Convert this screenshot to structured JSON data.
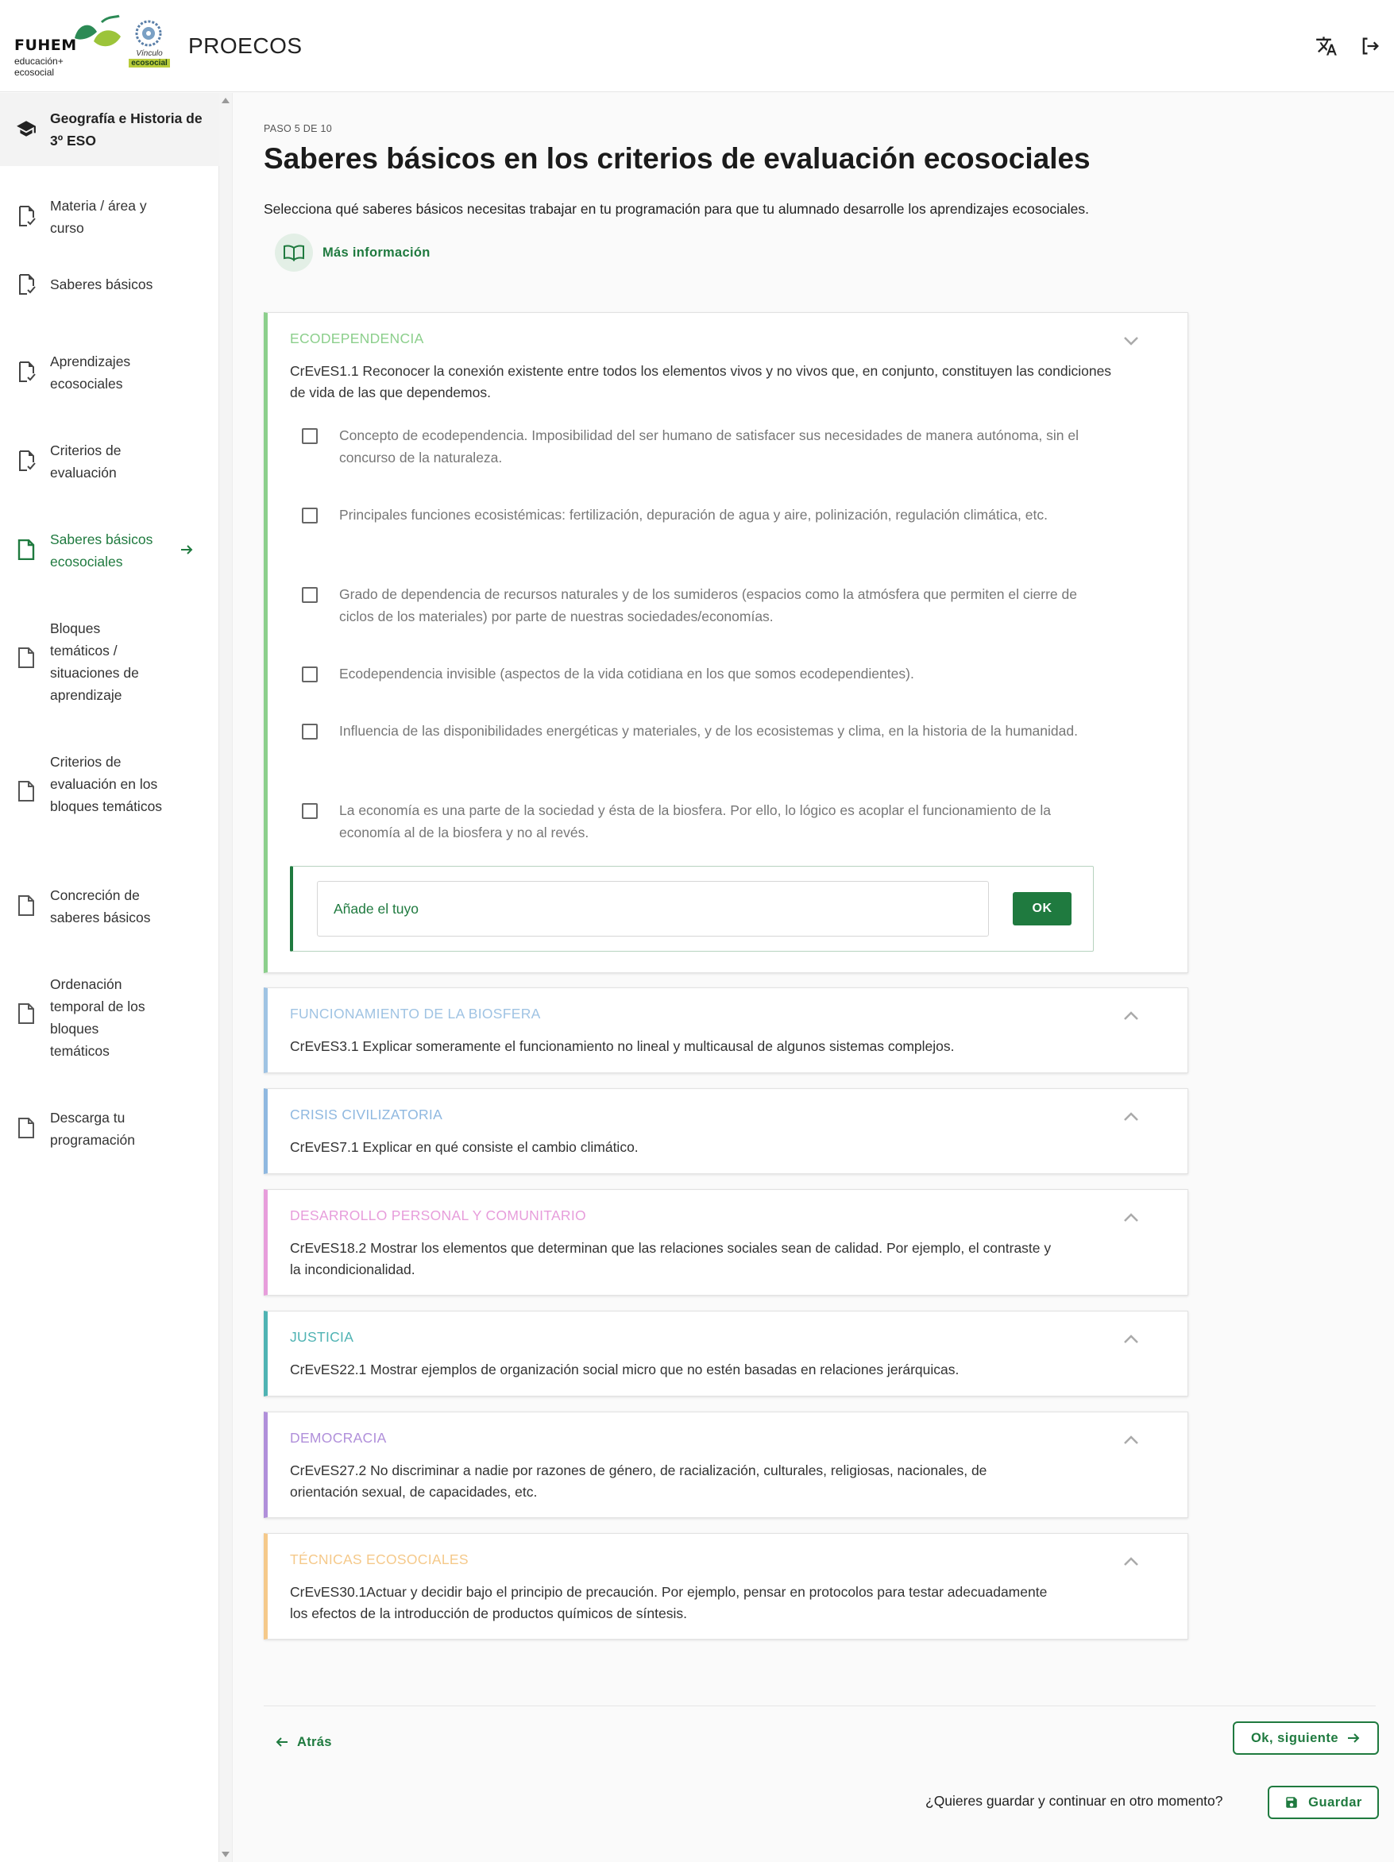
{
  "header": {
    "brand": "FUHEM",
    "brand_sub1": "educación+",
    "brand_sub2": "ecosocial",
    "vinculo_line1": "Vínculo",
    "vinculo_line2": "ecosocial",
    "app_title": "PROECOS",
    "icons": [
      "translate-icon",
      "logout-icon"
    ]
  },
  "sidebar": {
    "course": "Geografía e Historia de 3º ESO",
    "items": [
      {
        "label": "Materia / área y curso",
        "state": "done"
      },
      {
        "label": "Saberes básicos",
        "state": "done"
      },
      {
        "label": "Aprendizajes ecosociales",
        "state": "done"
      },
      {
        "label": "Criterios de evaluación",
        "state": "done"
      },
      {
        "label": "Saberes básicos ecosociales",
        "state": "active"
      },
      {
        "label": "Bloques temáticos / situaciones de aprendizaje",
        "state": "pending"
      },
      {
        "label": "Criterios de evaluación en los bloques temáticos",
        "state": "pending"
      },
      {
        "label": "Concreción de saberes básicos",
        "state": "pending"
      },
      {
        "label": "Ordenación temporal de los bloques temáticos",
        "state": "pending"
      },
      {
        "label": "Descarga tu programación",
        "state": "pending"
      }
    ]
  },
  "main": {
    "step": "PASO 5 DE 10",
    "title": "Saberes básicos en los criterios de evaluación ecosociales",
    "subtitle": "Selecciona qué saberes básicos necesitas trabajar en tu programación para que tu alumnado desarrolle los aprendizajes ecosociales.",
    "more_info": "Más información",
    "cards": [
      {
        "category": "ECODEPENDENCIA",
        "criterion": "CrEvES1.1 Reconocer la conexión existente entre todos los elementos vivos y no vivos que, en conjunto, constituyen las condiciones de vida de las que dependemos.",
        "color": "#8ccf8c",
        "expanded": true,
        "options": [
          "Concepto de ecodependencia. Imposibilidad del ser humano de satisfacer sus necesidades de manera autónoma, sin el concurso de la naturaleza.",
          "Principales funciones ecosistémicas: fertilización, depuración de agua y aire, polinización, regulación climática, etc.",
          "Grado de dependencia de recursos naturales y de los sumideros (espacios como la atmósfera que permiten el cierre de ciclos de los materiales) por parte de nuestras sociedades/economías.",
          "Ecodependencia invisible (aspectos de la vida cotidiana en los que somos ecodependientes).",
          "Influencia de las disponibilidades energéticas y materiales, y de los ecosistemas y clima, en la historia de la humanidad.",
          "La economía es una parte de la sociedad y ésta de la biosfera. Por ello, lo lógico es acoplar el funcionamiento de la economía al de la biosfera y no al revés."
        ],
        "add_placeholder": "Añade el tuyo",
        "ok_label": "OK"
      },
      {
        "category": "FUNCIONAMIENTO DE LA BIOSFERA",
        "criterion": "CrEvES3.1 Explicar someramente el funcionamiento no lineal y multicausal de algunos sistemas complejos.",
        "color": "#9fc3e3"
      },
      {
        "category": "CRISIS CIVILIZATORIA",
        "criterion": "CrEvES7.1 Explicar en qué consiste el cambio climático.",
        "color": "#8fb8e0"
      },
      {
        "category": "DESARROLLO PERSONAL Y COMUNITARIO",
        "criterion": "CrEvES18.2 Mostrar los elementos que determinan que las relaciones sociales sean de calidad. Por ejemplo, el contraste y la incondicionalidad.",
        "color": "#e79ddb"
      },
      {
        "category": "JUSTICIA",
        "criterion": "CrEvES22.1 Mostrar ejemplos de organización social micro que no estén basadas en relaciones jerárquicas.",
        "color": "#4fb3b3"
      },
      {
        "category": "DEMOCRACIA",
        "criterion": "CrEvES27.2 No discriminar a nadie por razones de género, de racialización, culturales, religiosas, nacionales, de orientación sexual, de capacidades, etc.",
        "color": "#b08fda"
      },
      {
        "category": "TÉCNICAS ECOSOCIALES",
        "criterion": "CrEvES30.1Actuar y decidir bajo el principio de precaución. Por ejemplo, pensar en protocolos para testar adecuadamente los efectos de la introducción de productos químicos de síntesis.",
        "color": "#f5c98a"
      }
    ],
    "footer": {
      "back_label": "Atrás",
      "next_label": "Ok, siguiente",
      "save_question": "¿Quieres guardar y continuar en otro momento?",
      "save_label": "Guardar"
    }
  }
}
